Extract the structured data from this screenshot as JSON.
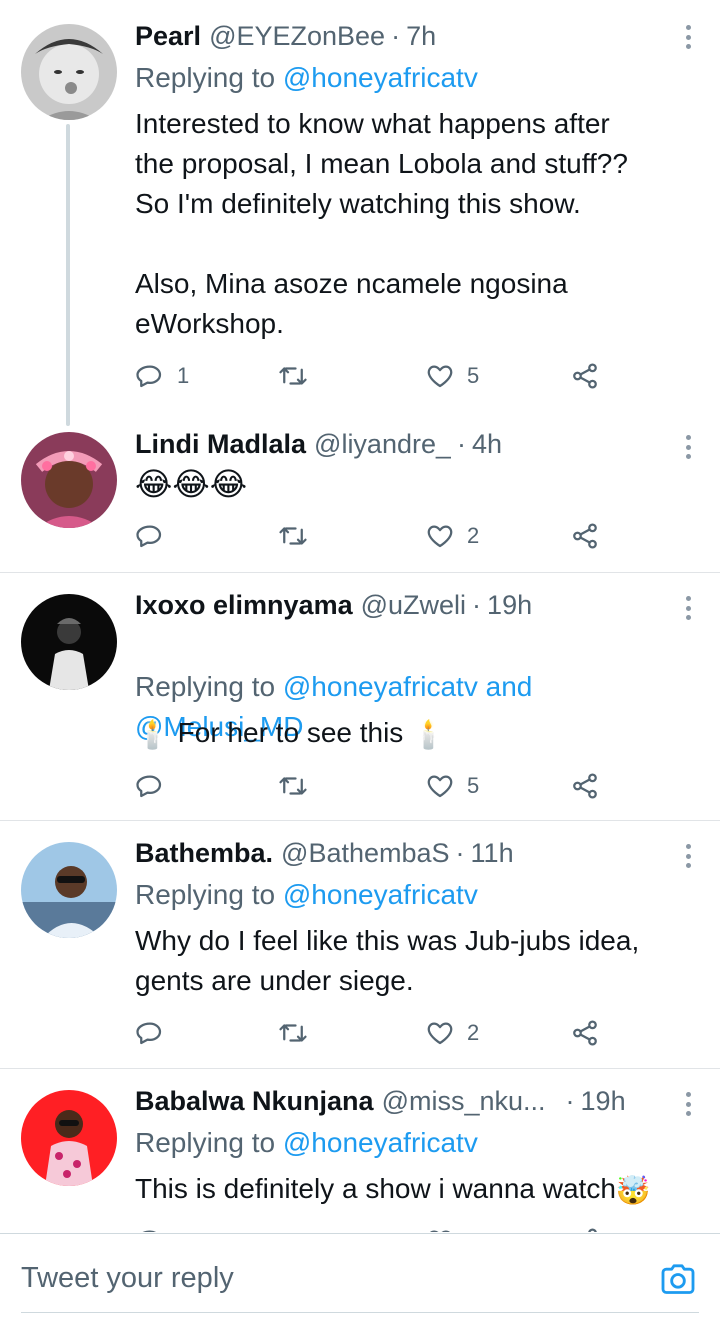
{
  "tweets": [
    {
      "name": "Pearl",
      "handle": "@EYEZonBee",
      "time": "7h",
      "replying_prefix": "Replying to ",
      "replying_to": "@honeyafricatv",
      "body": "Interested to know what happens after\nthe proposal, I mean Lobola and stuff??\nSo I'm definitely watching this show.\n\nAlso, Mina asoze ncamele ngosina\neWorkshop.",
      "replies": "1",
      "retweets": "",
      "likes": "5"
    },
    {
      "name": "Lindi Madlala",
      "handle": "@liyandre_",
      "time": "4h",
      "body": "😂😂😂",
      "replies": "",
      "retweets": "",
      "likes": "2"
    },
    {
      "name": "Ixoxo elimnyama",
      "handle": "@uZweli",
      "time": "19h",
      "replying_prefix": "Replying to ",
      "replying_to": "@honeyafricatv and\n@Melusi_MD",
      "body": "For her to see this",
      "emoji": "🕯️",
      "replies": "",
      "retweets": "",
      "likes": "5"
    },
    {
      "name": "Bathemba.",
      "handle": "@BathembaS",
      "time": "11h",
      "replying_prefix": "Replying to ",
      "replying_to": "@honeyafricatv",
      "body": "Why do I feel like this was Jub-jubs idea,\ngents are under siege.",
      "replies": "",
      "retweets": "",
      "likes": "2"
    },
    {
      "name": "Babalwa Nkunjana",
      "handle": "@miss_nku...",
      "time": "19h",
      "replying_prefix": "Replying to ",
      "replying_to": "@honeyafricatv",
      "body": "This is definitely a show i wanna watch",
      "emoji": "🤯"
    }
  ],
  "reply_bar": {
    "placeholder": "Tweet your reply"
  },
  "icons": {
    "reply": "reply-icon",
    "retweet": "retweet-icon",
    "like": "like-icon",
    "share": "share-icon",
    "more": "more-icon",
    "camera": "camera-icon"
  },
  "colors": {
    "link": "#1d9bf0",
    "secondary_text": "#536471",
    "primary_text": "#0f1419",
    "divider": "#e1e4e7",
    "thread_line": "#cfd9de"
  },
  "dot_separator": "·"
}
